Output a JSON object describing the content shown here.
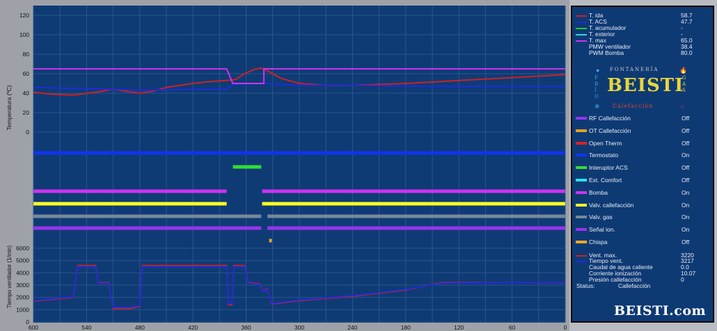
{
  "colors": {
    "background": "#0f3b75",
    "grid": "#2a5690",
    "t_ida": "#cc2222",
    "t_acs": "#1c2dd8",
    "t_acumulador": "#22cc33",
    "t_exterior": "#33d6e6",
    "t_max": "#cc33ee",
    "rf": "#9933ee",
    "ot": "#e6a020",
    "open_therm": "#dd2222",
    "termostato": "#1133ee",
    "interruptor_acs": "#33dd33",
    "ext_comfort": "#33ddee",
    "bomba": "#cc33ee",
    "valv_calefaccion": "#ffff22",
    "valv_gas": "#778899",
    "senal_ion": "#9933ee",
    "chispa": "#eeaa22"
  },
  "temperature_chart": {
    "ylabel": "Temperatura (ºC)",
    "yticks": [
      "120",
      "100",
      "80",
      "60",
      "40",
      "20",
      "0"
    ]
  },
  "fan_chart": {
    "ylabel": "Tiempo ventilador (1/min)",
    "yticks": [
      "6000",
      "5000",
      "4000",
      "3000",
      "2000",
      "1000",
      "0"
    ]
  },
  "x_axis": {
    "ticks": [
      "600",
      "540",
      "480",
      "420",
      "360",
      "300",
      "240",
      "180",
      "120",
      "60",
      "0"
    ]
  },
  "legend": {
    "items": [
      {
        "label": "T. ida",
        "value": "58.7"
      },
      {
        "label": "T. ACS",
        "value": "47.7"
      },
      {
        "label": "T. acumulador",
        "value": "-"
      },
      {
        "label": "T. exterior",
        "value": "-"
      },
      {
        "label": "T. max",
        "value": "65.0"
      },
      {
        "label": "PMW ventilador",
        "value": "38.4"
      },
      {
        "label": "PWM Bomba",
        "value": "80.0"
      }
    ]
  },
  "logo": {
    "top": "FONTANERÍA",
    "left": "FRÍO",
    "right": "GAS",
    "bottom": "Calefacción",
    "main": "BEISTI"
  },
  "digital": {
    "items": [
      {
        "label": "RF Callefacción",
        "value": "Off"
      },
      {
        "label": "OT Callefacción",
        "value": "Off"
      },
      {
        "label": "Open Therm",
        "value": "Off"
      },
      {
        "label": "Termostato",
        "value": "On"
      },
      {
        "label": "Interuptor ACS",
        "value": "Off"
      },
      {
        "label": "Ext. Comfort",
        "value": "Off"
      },
      {
        "label": "Bomba",
        "value": "On"
      },
      {
        "label": "Valv. callefacción",
        "value": "On"
      },
      {
        "label": "Valv. gas",
        "value": "On"
      },
      {
        "label": "Señal ion.",
        "value": "On"
      },
      {
        "label": "Chispa",
        "value": "Off"
      }
    ]
  },
  "fan_legend": {
    "vent_max_label": "Vent. max.",
    "vent_max_value": "3220",
    "tiempo_vent_label": "Tiempo vent.",
    "tiempo_vent_value": "3217"
  },
  "stats": {
    "caudal_label": "Caudal de agua caliente",
    "caudal_value": "0.0",
    "corriente_label": "Corriente ionización",
    "corriente_value": "10.07",
    "presion_label": "Presión callefacción",
    "presion_value": "0",
    "status_label": "Status:",
    "status_value": "Callefacción"
  },
  "brand": {
    "text": "BEISTI.com"
  },
  "chart_data": {
    "type": "line",
    "x_unit": "seconds ago",
    "temperature": {
      "ylim": [
        0,
        120
      ],
      "series": [
        {
          "name": "T. ida",
          "points": [
            [
              600,
              41
            ],
            [
              580,
              39
            ],
            [
              555,
              38
            ],
            [
              530,
              41
            ],
            [
              510,
              44
            ],
            [
              495,
              42
            ],
            [
              480,
              40
            ],
            [
              465,
              42
            ],
            [
              450,
              46
            ],
            [
              420,
              50
            ],
            [
              400,
              52
            ],
            [
              382,
              53
            ],
            [
              372,
              54
            ],
            [
              362,
              60
            ],
            [
              352,
              64
            ],
            [
              343,
              66
            ],
            [
              334,
              62
            ],
            [
              320,
              55
            ],
            [
              300,
              50
            ],
            [
              270,
              48
            ],
            [
              240,
              48
            ],
            [
              180,
              50
            ],
            [
              120,
              53
            ],
            [
              60,
              56
            ],
            [
              0,
              59
            ]
          ]
        },
        {
          "name": "T. ACS",
          "points": [
            [
              600,
              46
            ],
            [
              560,
              45
            ],
            [
              510,
              44
            ],
            [
              480,
              43
            ],
            [
              420,
              44
            ],
            [
              382,
              44
            ],
            [
              375,
              49
            ],
            [
              340,
              50
            ],
            [
              300,
              48
            ],
            [
              240,
              48
            ],
            [
              150,
              47
            ],
            [
              60,
              47
            ],
            [
              0,
              47
            ]
          ]
        },
        {
          "name": "T. max",
          "points": [
            [
              600,
              65
            ],
            [
              382,
              65
            ],
            [
              375,
              50
            ],
            [
              340,
              50
            ],
            [
              340,
              65
            ],
            [
              0,
              65
            ]
          ]
        }
      ]
    },
    "fan": {
      "ylim": [
        0,
        6000
      ],
      "series": [
        {
          "name": "Vent. max.",
          "points": [
            [
              600,
              1700
            ],
            [
              555,
              2000
            ],
            [
              550,
              4600
            ],
            [
              530,
              4600
            ],
            [
              527,
              3200
            ],
            [
              515,
              3200
            ],
            [
              510,
              1100
            ],
            [
              490,
              1100
            ],
            [
              480,
              1300
            ],
            [
              477,
              4600
            ],
            [
              382,
              4600
            ],
            [
              380,
              1400
            ],
            [
              376,
              1400
            ],
            [
              374,
              4600
            ],
            [
              362,
              4600
            ],
            [
              358,
              3200
            ],
            [
              345,
              3100
            ],
            [
              341,
              2500
            ],
            [
              336,
              2700
            ],
            [
              332,
              1500
            ],
            [
              326,
              1500
            ],
            [
              306,
              1700
            ],
            [
              240,
              2100
            ],
            [
              180,
              2600
            ],
            [
              140,
              3200
            ],
            [
              60,
              3200
            ],
            [
              0,
              3200
            ]
          ]
        },
        {
          "name": "Tiempo vent.",
          "points": [
            [
              600,
              1750
            ],
            [
              555,
              2050
            ],
            [
              550,
              4500
            ],
            [
              530,
              4500
            ],
            [
              527,
              3150
            ],
            [
              515,
              3150
            ],
            [
              510,
              1200
            ],
            [
              490,
              1200
            ],
            [
              480,
              1350
            ],
            [
              477,
              4500
            ],
            [
              382,
              4500
            ],
            [
              380,
              1500
            ],
            [
              376,
              1500
            ],
            [
              374,
              4500
            ],
            [
              362,
              4500
            ],
            [
              358,
              3150
            ],
            [
              345,
              3050
            ],
            [
              341,
              2450
            ],
            [
              336,
              2650
            ],
            [
              332,
              1550
            ],
            [
              326,
              1550
            ],
            [
              306,
              1750
            ],
            [
              240,
              2150
            ],
            [
              180,
              2650
            ],
            [
              140,
              3150
            ],
            [
              60,
              3200
            ],
            [
              0,
              3217
            ]
          ]
        }
      ]
    },
    "digital_segments": [
      {
        "name": "Termostato",
        "segments": [
          [
            600,
            0
          ]
        ]
      },
      {
        "name": "Interuptor ACS",
        "segments": [
          [
            375,
            343
          ]
        ]
      },
      {
        "name": "Bomba",
        "segments": [
          [
            600,
            382
          ],
          [
            342,
            0
          ]
        ]
      },
      {
        "name": "Valv. callefacción",
        "segments": [
          [
            600,
            382
          ],
          [
            342,
            0
          ]
        ]
      },
      {
        "name": "Valv. gas",
        "segments": [
          [
            600,
            343
          ],
          [
            336,
            0
          ]
        ]
      },
      {
        "name": "Señal ion.",
        "segments": [
          [
            600,
            343
          ],
          [
            336,
            0
          ]
        ]
      },
      {
        "name": "Chispa",
        "segments": [
          [
            334,
            331
          ]
        ]
      }
    ]
  }
}
